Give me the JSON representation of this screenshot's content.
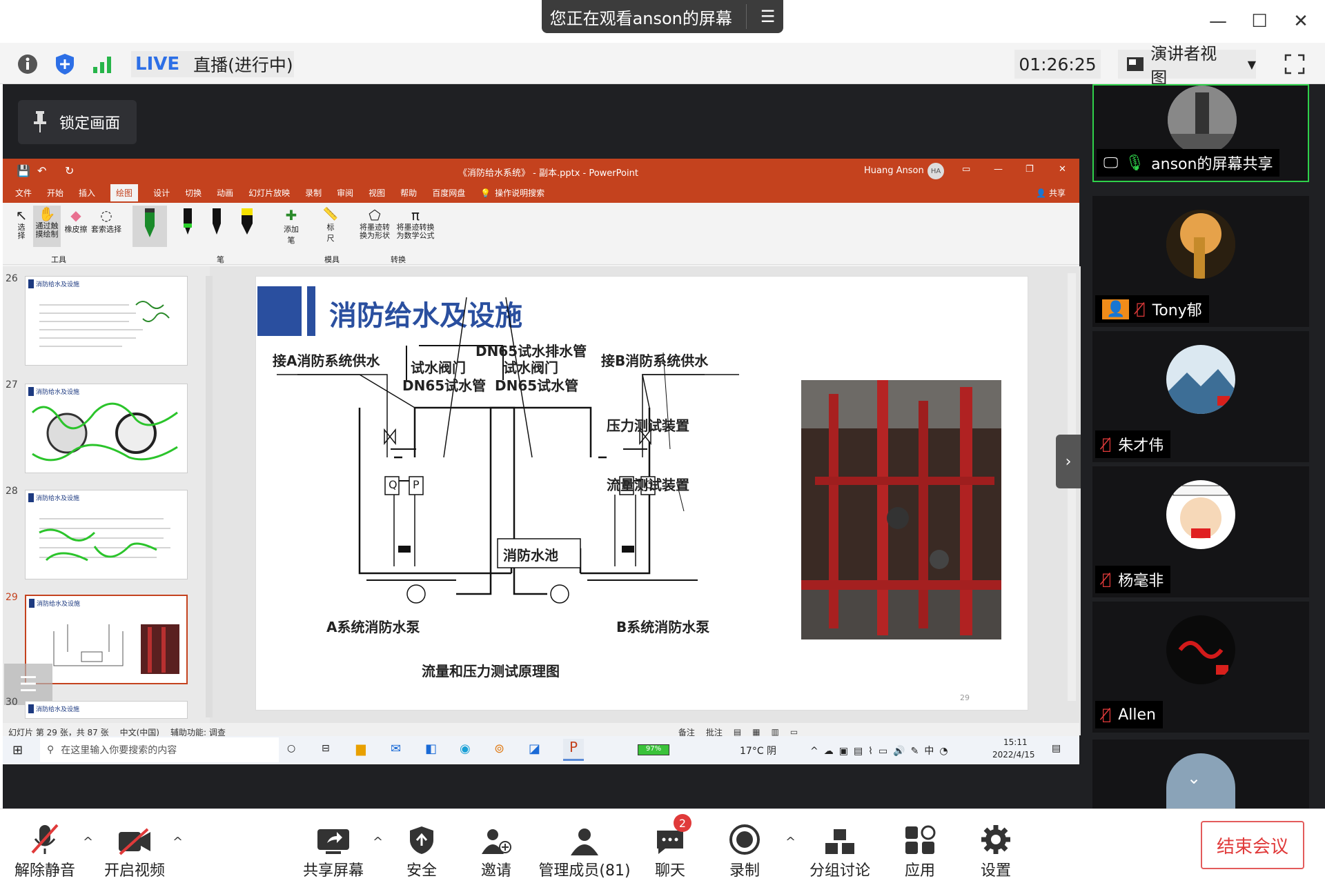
{
  "banner": {
    "text": "您正在观看anson的屏幕"
  },
  "meeting": {
    "live": "LIVE",
    "live_status": "直播(进行中)",
    "timer": "01:26:25",
    "view": "演讲者视图"
  },
  "lock": "锁定画面",
  "ppt": {
    "title": "《消防给水系统》 - 副本.pptx - PowerPoint",
    "user": "Huang Anson",
    "user_initials": "HA",
    "tabs": [
      "文件",
      "开始",
      "插入",
      "绘图",
      "设计",
      "切换",
      "动画",
      "幻灯片放映",
      "录制",
      "审阅",
      "视图",
      "帮助",
      "百度网盘"
    ],
    "active_tab": "绘图",
    "search": "操作说明搜索",
    "share": "共享",
    "ribbon": {
      "select": "选择",
      "draw_touch": "通过触摸绘制",
      "eraser": "橡皮擦",
      "lasso": "套索选择",
      "tools_group": "工具",
      "add_pen": "添加笔",
      "pen_group": "笔",
      "ruler": "标尺",
      "stencil_group": "模具",
      "ink_to_shape": "将墨迹转换为形状",
      "ink_to_math": "将墨迹转换为数学公式",
      "convert_group": "转换"
    },
    "thumb_numbers": [
      "26",
      "27",
      "28",
      "29",
      "30"
    ],
    "thumb_title": "消防给水及设施",
    "slide": {
      "title": "消防给水及设施",
      "labels": {
        "a_supply": "接A消防系统供水",
        "b_supply": "接B消防系统供水",
        "drain": "DN65试水排水管",
        "valve_l": "试水阀门",
        "pipe_l": "DN65试水管",
        "valve_r": "试水阀门",
        "pipe_r": "DN65试水管",
        "pressure": "压力测试装置",
        "flow": "流量测试装置",
        "pool": "消防水池",
        "pump_a": "A系统消防水泵",
        "pump_b": "B系统消防水泵",
        "caption": "流量和压力测试原理图",
        "q": "Q",
        "p": "P"
      },
      "page": "29"
    },
    "status": {
      "slide_info": "幻灯片 第 29 张，共 87 张",
      "lang": "中文(中国)",
      "access": "辅助功能: 调查",
      "notes": "备注",
      "comments": "批注"
    }
  },
  "taskbar": {
    "search": "在这里输入你要搜索的内容",
    "battery": "97%",
    "weather": "17°C 阴",
    "time": "15:11",
    "date": "2022/4/15"
  },
  "participants": [
    {
      "name": "anson的屏幕共享",
      "muted": false
    },
    {
      "name": "Tony郁",
      "muted": true
    },
    {
      "name": "朱才伟",
      "muted": true
    },
    {
      "name": "杨毫非",
      "muted": true
    },
    {
      "name": "Allen",
      "muted": true
    }
  ],
  "toolbar": {
    "mute": "解除静音",
    "video": "开启视频",
    "share": "共享屏幕",
    "security": "安全",
    "invite": "邀请",
    "participants": "管理成员(81)",
    "chat": "聊天",
    "chat_badge": "2",
    "record": "录制",
    "breakout": "分组讨论",
    "apps": "应用",
    "settings": "设置",
    "end": "结束会议"
  },
  "colors": {
    "ppt_accent": "#c4421e",
    "zoom_blue": "#2d6fe6",
    "end_red": "#e03a3a",
    "slide_blue": "#2a4f9f"
  }
}
